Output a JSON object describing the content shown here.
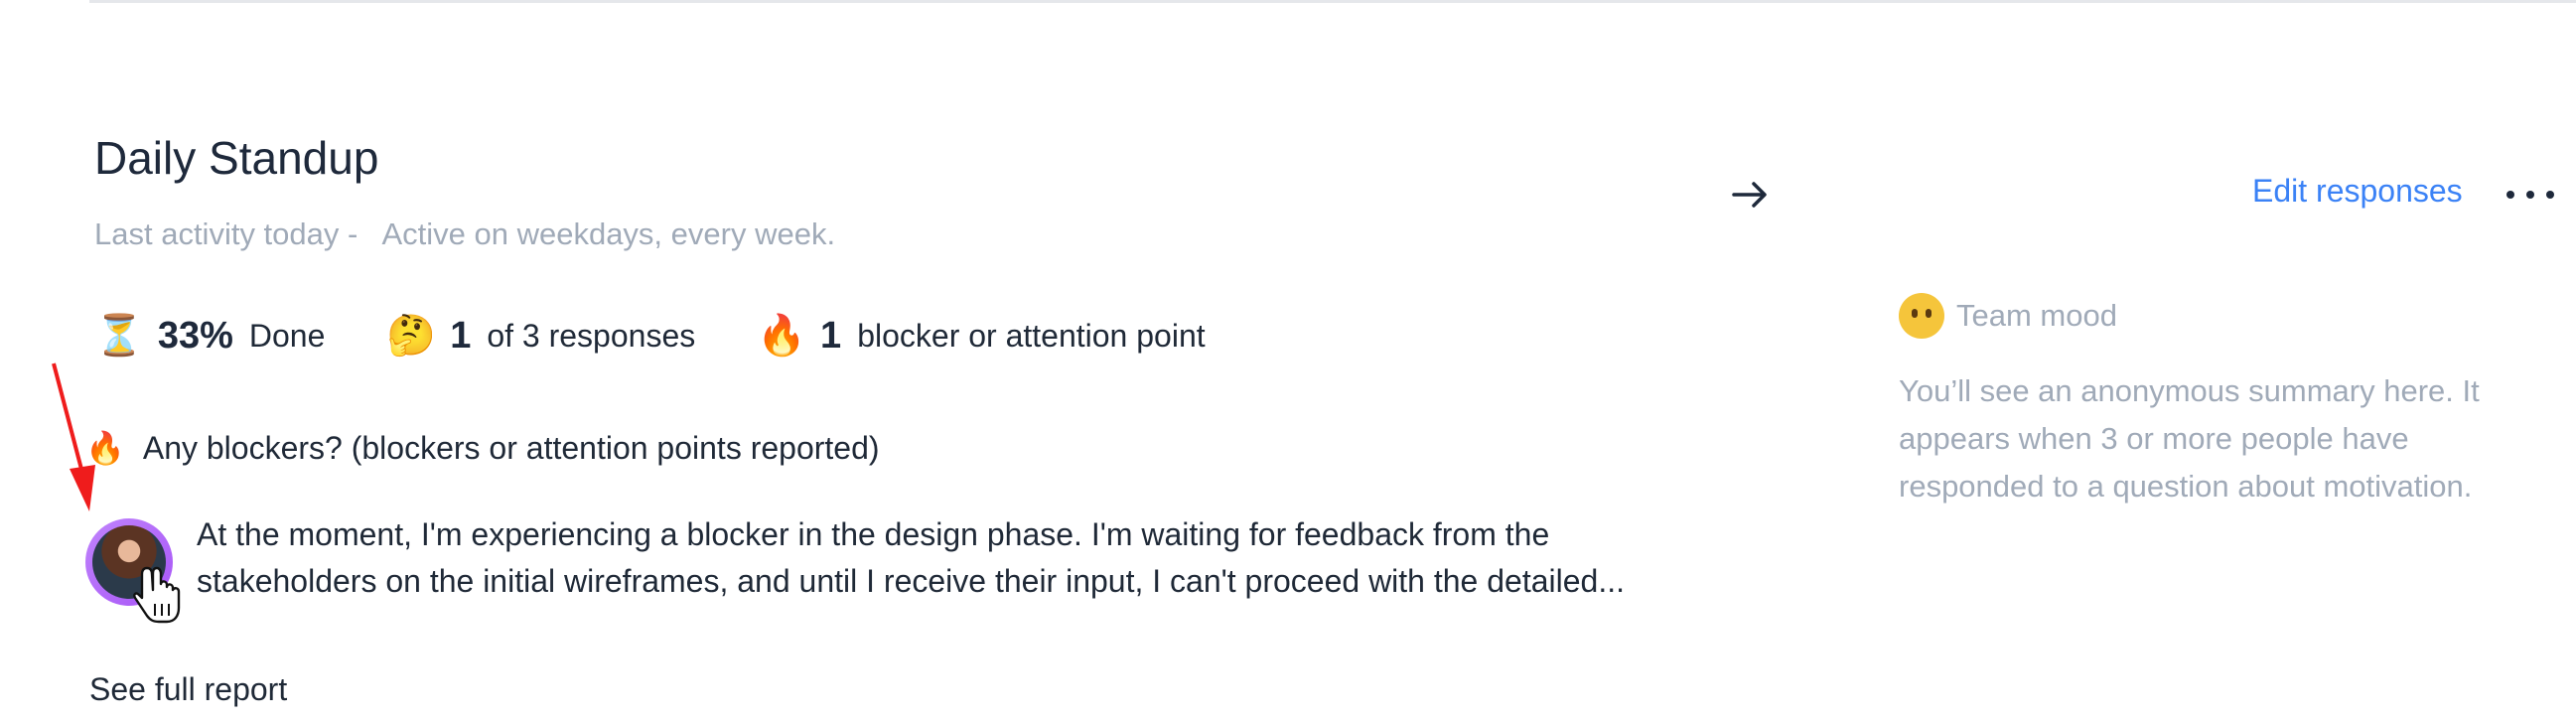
{
  "header": {
    "title": "Daily Standup",
    "subtitle": "Last activity today -   Active on weekdays, every week."
  },
  "stats": [
    {
      "emoji": "⏳",
      "icon": "hourglass-icon",
      "number": "33%",
      "label": "Done"
    },
    {
      "emoji": "🤔",
      "icon": "thinking-face-icon",
      "number": "1",
      "label": "of 3 responses"
    },
    {
      "emoji": "🔥",
      "icon": "fire-icon",
      "number": "1",
      "label": "blocker or attention point"
    }
  ],
  "blockers": {
    "emoji": "🔥",
    "heading": "Any blockers? (blockers or attention points reported)",
    "response": "At the moment, I'm experiencing a blocker in the design phase. I'm waiting for feedback from the stakeholders on the initial wireframes, and until I receive their input, I can't proceed with the detailed..."
  },
  "footer": {
    "see_full_report": "See full report"
  },
  "actions": {
    "next_arrow": "→",
    "edit_responses": "Edit responses"
  },
  "mood": {
    "title": "Team mood",
    "description": "You’ll see an anonymous summary here. It appears when 3 or more people have responded to a question about motivation."
  },
  "colors": {
    "accent": "#3b82f6",
    "muted": "#a0aab8",
    "annotation": "#ef1c1c"
  }
}
